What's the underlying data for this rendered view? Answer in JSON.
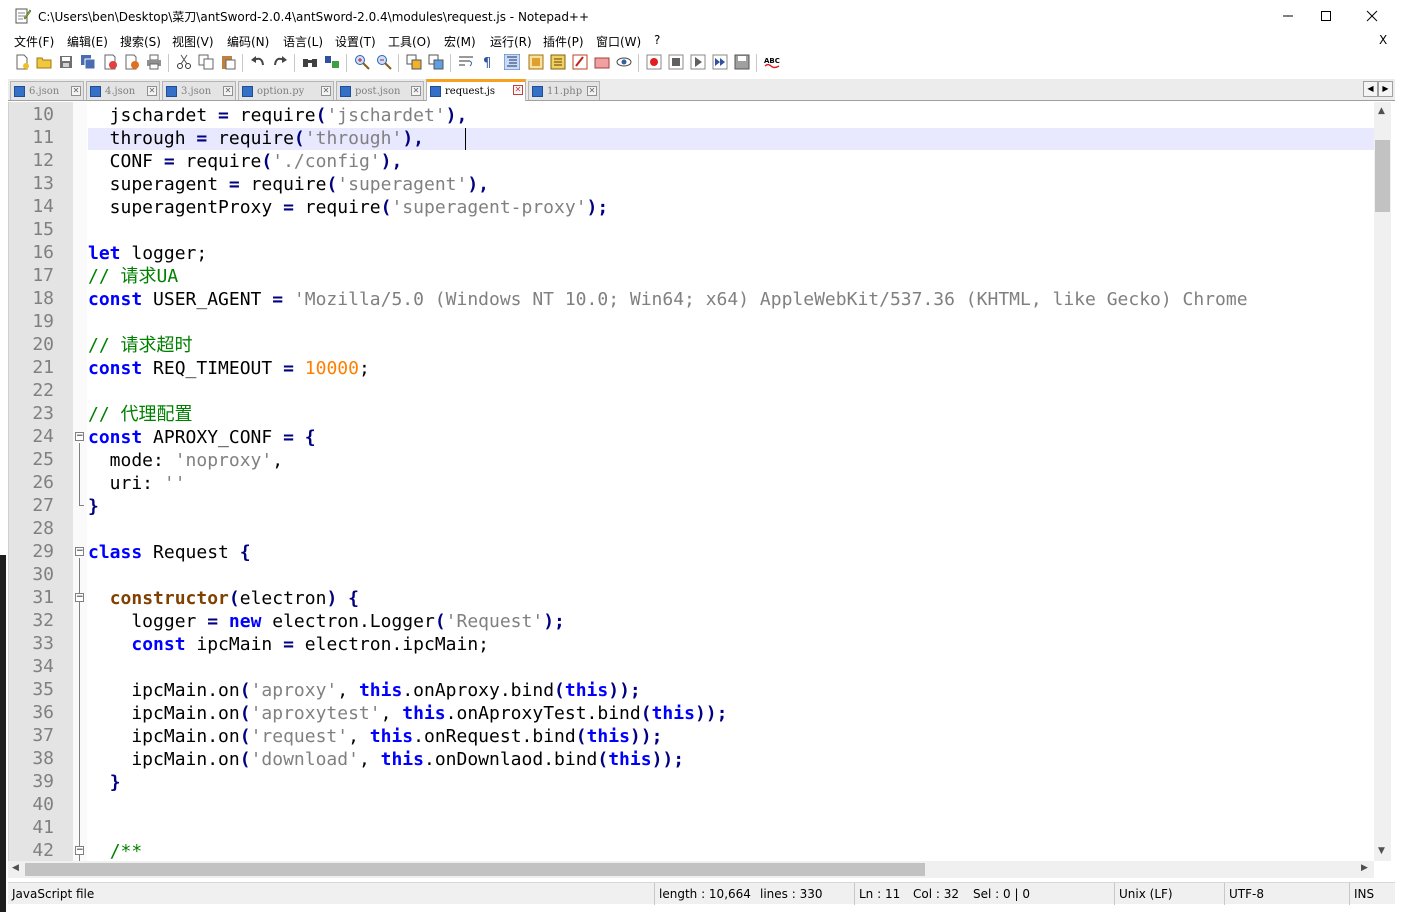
{
  "window": {
    "title": "C:\\Users\\ben\\Desktop\\菜刀\\antSword-2.0.4\\antSword-2.0.4\\modules\\request.js - Notepad++",
    "minimize": "—",
    "maximize": "☐",
    "close": "✕"
  },
  "menu": {
    "items": [
      "文件(F)",
      "编辑(E)",
      "搜索(S)",
      "视图(V)",
      "编码(N)",
      "语言(L)",
      "设置(T)",
      "工具(O)",
      "宏(M)",
      "运行(R)",
      "插件(P)",
      "窗口(W)",
      "?"
    ],
    "close_doc": "X"
  },
  "tabs": [
    {
      "label": "6.json",
      "active": false
    },
    {
      "label": "4.json",
      "active": false
    },
    {
      "label": "3.json",
      "active": false
    },
    {
      "label": "option.py",
      "active": false
    },
    {
      "label": "post.json",
      "active": false
    },
    {
      "label": "request.js",
      "active": true
    },
    {
      "label": "11.php",
      "active": false
    }
  ],
  "editor": {
    "line_numbers": [
      "10",
      "11",
      "12",
      "13",
      "14",
      "15",
      "16",
      "17",
      "18",
      "19",
      "20",
      "21",
      "22",
      "23",
      "24",
      "25",
      "26",
      "27",
      "28",
      "29",
      "30",
      "31",
      "32",
      "33",
      "34",
      "35",
      "36",
      "37",
      "38",
      "39",
      "40",
      "41",
      "42"
    ],
    "lines": [
      [
        [
          "",
          "  jschardet "
        ],
        [
          "op",
          "="
        ],
        [
          "",
          " require"
        ],
        [
          "op",
          "("
        ],
        [
          "str",
          "'jschardet'"
        ],
        [
          "op",
          "),"
        ]
      ],
      [
        [
          "",
          "  through "
        ],
        [
          "op",
          "="
        ],
        [
          "",
          " require"
        ],
        [
          "op",
          "("
        ],
        [
          "str",
          "'through'"
        ],
        [
          "op",
          "),"
        ]
      ],
      [
        [
          "",
          "  CONF "
        ],
        [
          "op",
          "="
        ],
        [
          "",
          " require"
        ],
        [
          "op",
          "("
        ],
        [
          "str",
          "'./config'"
        ],
        [
          "op",
          "),"
        ]
      ],
      [
        [
          "",
          "  superagent "
        ],
        [
          "op",
          "="
        ],
        [
          "",
          " require"
        ],
        [
          "op",
          "("
        ],
        [
          "str",
          "'superagent'"
        ],
        [
          "op",
          "),"
        ]
      ],
      [
        [
          "",
          "  superagentProxy "
        ],
        [
          "op",
          "="
        ],
        [
          "",
          " require"
        ],
        [
          "op",
          "("
        ],
        [
          "str",
          "'superagent-proxy'"
        ],
        [
          "op",
          ");"
        ]
      ],
      [],
      [
        [
          "kw",
          "let"
        ],
        [
          "",
          " logger;"
        ]
      ],
      [
        [
          "cmt",
          "// 请求UA"
        ]
      ],
      [
        [
          "kw",
          "const"
        ],
        [
          "",
          " USER_AGENT "
        ],
        [
          "op",
          "="
        ],
        [
          "",
          " "
        ],
        [
          "str",
          "'Mozilla/5.0 (Windows NT 10.0; Win64; x64) AppleWebKit/537.36 (KHTML, like Gecko) Chrome"
        ]
      ],
      [],
      [
        [
          "cmt",
          "// 请求超时"
        ]
      ],
      [
        [
          "kw",
          "const"
        ],
        [
          "",
          " REQ_TIMEOUT "
        ],
        [
          "op",
          "="
        ],
        [
          "",
          " "
        ],
        [
          "num",
          "10000"
        ],
        [
          "",
          ";"
        ]
      ],
      [],
      [
        [
          "cmt",
          "// 代理配置"
        ]
      ],
      [
        [
          "kw",
          "const"
        ],
        [
          "",
          " APROXY_CONF "
        ],
        [
          "op",
          "="
        ],
        [
          "",
          " "
        ],
        [
          "op",
          "{"
        ]
      ],
      [
        [
          "",
          "  mode: "
        ],
        [
          "str",
          "'noproxy'"
        ],
        [
          "",
          ","
        ]
      ],
      [
        [
          "",
          "  uri: "
        ],
        [
          "str",
          "''"
        ]
      ],
      [
        [
          "op",
          "}"
        ]
      ],
      [],
      [
        [
          "kw",
          "class"
        ],
        [
          "",
          " Request "
        ],
        [
          "op",
          "{"
        ]
      ],
      [],
      [
        [
          "",
          "  "
        ],
        [
          "kw2",
          "constructor"
        ],
        [
          "op",
          "("
        ],
        [
          "",
          "electron"
        ],
        [
          "op",
          ")"
        ],
        [
          "",
          " "
        ],
        [
          "op",
          "{"
        ]
      ],
      [
        [
          "",
          "    logger "
        ],
        [
          "op",
          "="
        ],
        [
          "",
          " "
        ],
        [
          "kw",
          "new"
        ],
        [
          "",
          " electron.Logger"
        ],
        [
          "op",
          "("
        ],
        [
          "str",
          "'Request'"
        ],
        [
          "op",
          ");"
        ]
      ],
      [
        [
          "",
          "    "
        ],
        [
          "kw",
          "const"
        ],
        [
          "",
          " ipcMain "
        ],
        [
          "op",
          "="
        ],
        [
          "",
          " electron.ipcMain;"
        ]
      ],
      [],
      [
        [
          "",
          "    ipcMain.on"
        ],
        [
          "op",
          "("
        ],
        [
          "str",
          "'aproxy'"
        ],
        [
          "",
          ", "
        ],
        [
          "kw",
          "this"
        ],
        [
          "",
          ".onAproxy.bind"
        ],
        [
          "op",
          "("
        ],
        [
          "kw",
          "this"
        ],
        [
          "op",
          "));"
        ]
      ],
      [
        [
          "",
          "    ipcMain.on"
        ],
        [
          "op",
          "("
        ],
        [
          "str",
          "'aproxytest'"
        ],
        [
          "",
          ", "
        ],
        [
          "kw",
          "this"
        ],
        [
          "",
          ".onAproxyTest.bind"
        ],
        [
          "op",
          "("
        ],
        [
          "kw",
          "this"
        ],
        [
          "op",
          "));"
        ]
      ],
      [
        [
          "",
          "    ipcMain.on"
        ],
        [
          "op",
          "("
        ],
        [
          "str",
          "'request'"
        ],
        [
          "",
          ", "
        ],
        [
          "kw",
          "this"
        ],
        [
          "",
          ".onRequest.bind"
        ],
        [
          "op",
          "("
        ],
        [
          "kw",
          "this"
        ],
        [
          "op",
          "));"
        ]
      ],
      [
        [
          "",
          "    ipcMain.on"
        ],
        [
          "op",
          "("
        ],
        [
          "str",
          "'download'"
        ],
        [
          "",
          ", "
        ],
        [
          "kw",
          "this"
        ],
        [
          "",
          ".onDownlaod.bind"
        ],
        [
          "op",
          "("
        ],
        [
          "kw",
          "this"
        ],
        [
          "op",
          "));"
        ]
      ],
      [
        [
          "",
          "  "
        ],
        [
          "op",
          "}"
        ]
      ],
      [],
      [],
      [
        [
          "",
          "  "
        ],
        [
          "cmt",
          "/**"
        ]
      ]
    ],
    "current_line_index": 1
  },
  "status": {
    "filetype": "JavaScript file",
    "length": "length : 10,664",
    "lines": "lines : 330",
    "ln": "Ln : 11",
    "col": "Col : 32",
    "sel": "Sel : 0 | 0",
    "eol": "Unix (LF)",
    "encoding": "UTF-8",
    "mode": "INS"
  },
  "colors": {
    "keyword": "#0000ff",
    "string": "#808080",
    "number": "#ff8000",
    "comment": "#008000",
    "operator": "#000080",
    "current_line": "#e8e8ff",
    "active_tab_accent": "#f8a020"
  }
}
